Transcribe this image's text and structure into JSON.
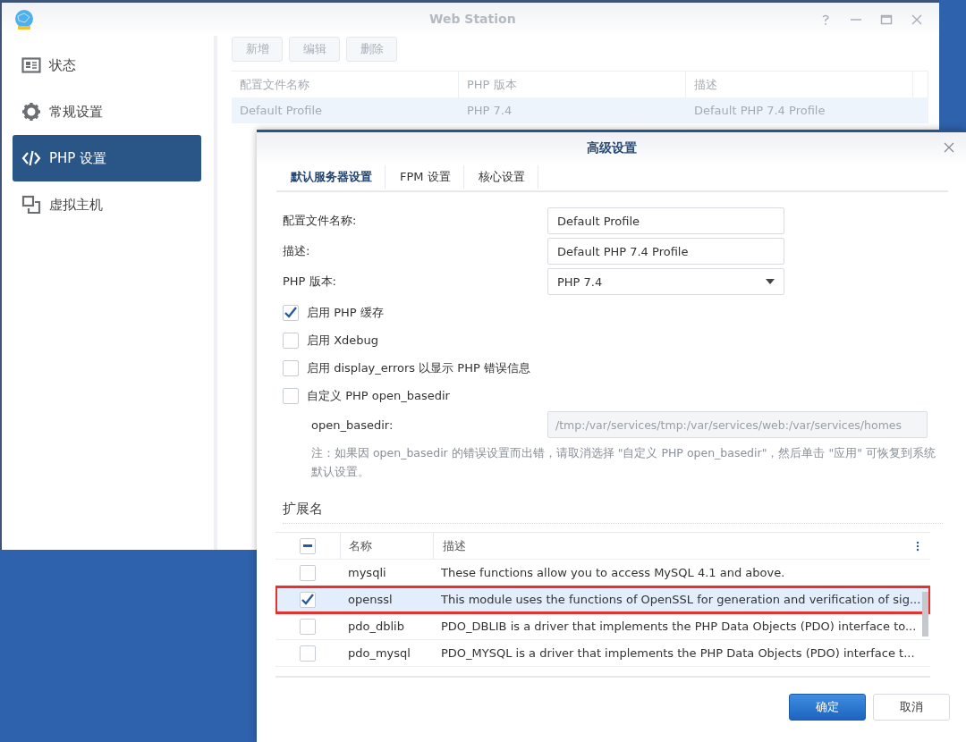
{
  "main_window": {
    "title": "Web Station",
    "sidebar": {
      "items": [
        {
          "label": "状态",
          "kind": "status",
          "selected": false
        },
        {
          "label": "常规设置",
          "kind": "general",
          "selected": false
        },
        {
          "label": "PHP 设置",
          "kind": "php",
          "selected": true
        },
        {
          "label": "虚拟主机",
          "kind": "vhost",
          "selected": false
        }
      ]
    },
    "toolbar": {
      "buttons": [
        {
          "label": "新增",
          "disabled": true
        },
        {
          "label": "编辑",
          "disabled": true
        },
        {
          "label": "删除",
          "disabled": true
        }
      ]
    },
    "table": {
      "columns": [
        "配置文件名称",
        "PHP 版本",
        "描述"
      ],
      "rows": [
        {
          "cells": [
            "Default Profile",
            "PHP 7.4",
            "Default PHP 7.4 Profile"
          ],
          "selected": true
        }
      ]
    }
  },
  "dialog": {
    "title": "高级设置",
    "tabs": [
      {
        "label": "默认服务器设置",
        "selected": true
      },
      {
        "label": "FPM 设置",
        "selected": false
      },
      {
        "label": "核心设置",
        "selected": false
      }
    ],
    "fields": [
      {
        "label": "配置文件名称:",
        "value": "Default Profile",
        "kind": "text"
      },
      {
        "label": "描述:",
        "value": "Default PHP 7.4 Profile",
        "kind": "text"
      },
      {
        "label": "PHP 版本:",
        "value": "PHP 7.4",
        "kind": "select"
      }
    ],
    "options": [
      {
        "label": "启用 PHP 缓存",
        "checked": true
      },
      {
        "label": "启用 Xdebug",
        "checked": false
      },
      {
        "label": "启用 display_errors 以显示 PHP 错误信息",
        "checked": false
      },
      {
        "label": "自定义 PHP open_basedir",
        "checked": false
      }
    ],
    "open_basedir": {
      "label": "open_basedir:",
      "value": "/tmp:/var/services/tmp:/var/services/web:/var/services/homes",
      "disabled": true
    },
    "note": "注：如果因 open_basedir 的错误设置而出错，请取消选择 \"自定义 PHP open_basedir\"，然后单击 \"应用\" 可恢复到系统默认设置。",
    "extensions": {
      "title": "扩展名",
      "indeterminate": true,
      "columns": [
        "名称",
        "描述"
      ],
      "rows": [
        {
          "name": "mysqli",
          "description": "These functions allow you to access MySQL 4.1 and above.",
          "checked": false,
          "selected": false,
          "highlighted": false
        },
        {
          "name": "openssl",
          "description": "This module uses the functions of OpenSSL for generation and verification of sig...",
          "checked": true,
          "selected": true,
          "highlighted": true
        },
        {
          "name": "pdo_dblib",
          "description": "PDO_DBLIB is a driver that implements the PHP Data Objects (PDO) interface to...",
          "checked": false,
          "selected": false,
          "highlighted": false
        },
        {
          "name": "pdo_mysql",
          "description": "PDO_MYSQL is a driver that implements the PHP Data Objects (PDO) interface t...",
          "checked": false,
          "selected": false,
          "highlighted": false
        }
      ]
    },
    "buttons": [
      {
        "label": "确定",
        "kind": "primary"
      },
      {
        "label": "取消",
        "kind": "secondary"
      }
    ]
  }
}
